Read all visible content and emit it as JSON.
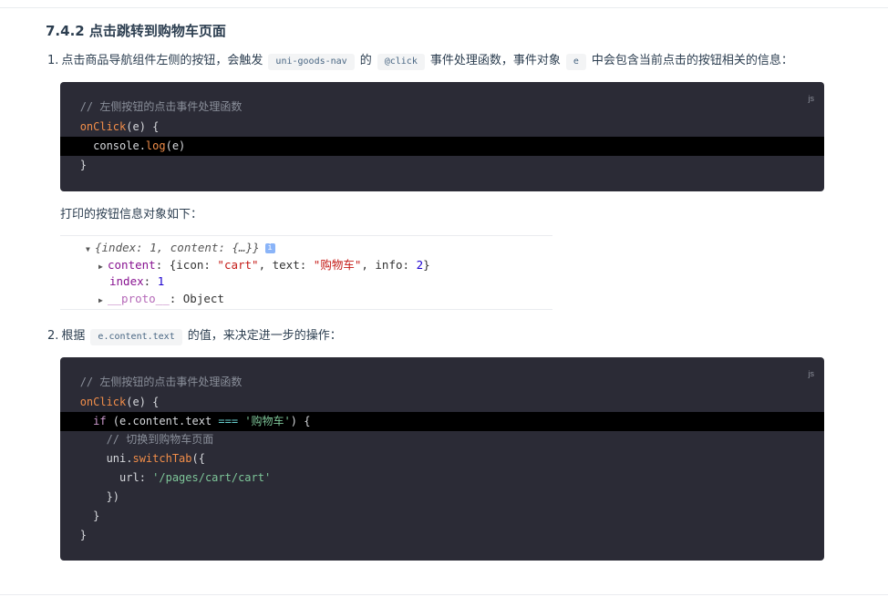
{
  "heading": "7.4.2 点击跳转到购物车页面",
  "step1": {
    "num": "1.",
    "before": "点击商品导航组件左侧的按钮，会触发",
    "code1": "uni-goods-nav",
    "mid1": "的",
    "code2": "@click",
    "mid2": "事件处理函数，事件对象",
    "code3": "e",
    "after": "中会包含当前点击的按钮相关的信息："
  },
  "code_block_1": {
    "lang": "js",
    "lines": {
      "l1_comment": "// 左侧按钮的点击事件处理函数",
      "l2_fn": "onClick",
      "l2_rest": "(e) {",
      "l3_obj": "console.",
      "l3_fn": "log",
      "l3_rest": "(e)",
      "l4": "}"
    }
  },
  "print_label": "打印的按钮信息对象如下：",
  "console": {
    "summary": "{index: 1, content: {…}}",
    "info_badge": "i",
    "content_key": "content",
    "content_open": ": {icon: ",
    "content_icon": "\"cart\"",
    "content_mid": ", text: ",
    "content_text": "\"购物车\"",
    "content_mid2": ", info: ",
    "content_info": "2",
    "content_close": "}",
    "index_key": "index",
    "index_sep": ": ",
    "index_val": "1",
    "proto_key": "__proto__",
    "proto_val": ": Object"
  },
  "step2": {
    "num": "2.",
    "before": "根据",
    "code": "e.content.text",
    "after": "的值，来决定进一步的操作："
  },
  "code_block_2": {
    "lang": "js",
    "lines": {
      "l1_comment": "// 左侧按钮的点击事件处理函数",
      "l2_fn": "onClick",
      "l2_rest": "(e) {",
      "l3_kw": "if",
      "l3_a": " (e.content.text ",
      "l3_op": "===",
      "l3_str": " '购物车'",
      "l3_b": ") {",
      "l4_comment": "// 切换到购物车页面",
      "l5_obj": "uni.",
      "l5_fn": "switchTab",
      "l5_rest": "({",
      "l6_key": "url: ",
      "l6_str": "'/pages/cart/cart'",
      "l7": "})",
      "l8": "}",
      "l9": "}"
    }
  }
}
